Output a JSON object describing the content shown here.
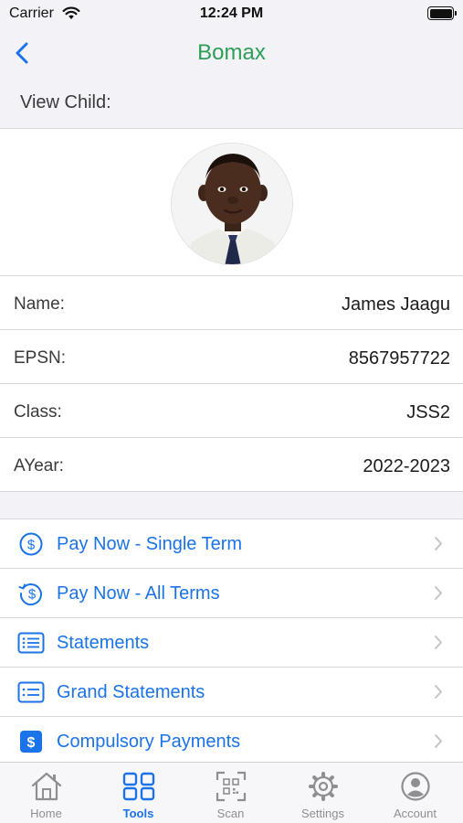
{
  "status_bar": {
    "carrier": "Carrier",
    "time": "12:24 PM"
  },
  "nav": {
    "title": "Bomax"
  },
  "page": {
    "section_title": "View Child:"
  },
  "child": {
    "fields": [
      {
        "label": "Name:",
        "value": "James Jaagu"
      },
      {
        "label": "EPSN:",
        "value": "8567957722"
      },
      {
        "label": "Class:",
        "value": "JSS2"
      },
      {
        "label": "AYear:",
        "value": "2022-2023"
      }
    ]
  },
  "menu": {
    "items": [
      {
        "label": "Pay Now - Single Term",
        "icon": "dollar-circle-icon"
      },
      {
        "label": "Pay Now - All Terms",
        "icon": "dollar-refresh-icon"
      },
      {
        "label": "Statements",
        "icon": "list-document-icon"
      },
      {
        "label": "Grand Statements",
        "icon": "list-card-icon"
      },
      {
        "label": "Compulsory Payments",
        "icon": "dollar-square-icon"
      }
    ]
  },
  "tabs": [
    {
      "label": "Home",
      "icon": "house-icon",
      "active": false
    },
    {
      "label": "Tools",
      "icon": "grid-icon",
      "active": true
    },
    {
      "label": "Scan",
      "icon": "qr-scan-icon",
      "active": false
    },
    {
      "label": "Settings",
      "icon": "gear-icon",
      "active": false
    },
    {
      "label": "Account",
      "icon": "person-circle-icon",
      "active": false
    }
  ],
  "colors": {
    "title_green": "#2e9e57",
    "accent_blue": "#1a73e8",
    "inactive_gray": "#8e8e93",
    "background": "#f2f2f7"
  }
}
